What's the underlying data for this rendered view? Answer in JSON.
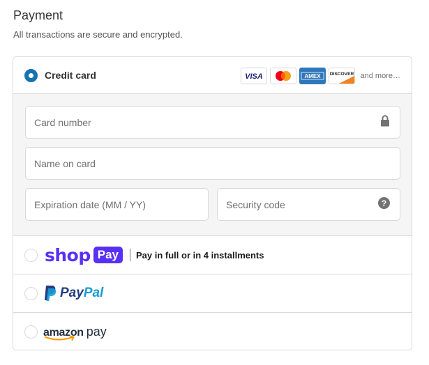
{
  "header": {
    "title": "Payment",
    "subtitle": "All transactions are secure and encrypted."
  },
  "credit_card": {
    "label": "Credit card",
    "selected": true,
    "card_brands": [
      {
        "name": "VISA",
        "icon": "visa-icon"
      },
      {
        "name": "Mastercard",
        "icon": "mastercard-icon"
      },
      {
        "name": "AMEX",
        "icon": "amex-icon"
      },
      {
        "name": "DISCOVER",
        "icon": "discover-icon"
      }
    ],
    "more_label": "and more…",
    "fields": {
      "card_number_placeholder": "Card number",
      "name_on_card_placeholder": "Name on card",
      "expiration_placeholder": "Expiration date (MM / YY)",
      "security_code_placeholder": "Security code"
    }
  },
  "shop_pay": {
    "shop_text": "shop",
    "pay_text": "Pay",
    "description": "Pay in full or in 4 installments",
    "selected": false
  },
  "paypal": {
    "pay_text": "Pay",
    "pal_text": "Pal",
    "selected": false
  },
  "amazon_pay": {
    "amazon_text": "amazon",
    "pay_text": "pay",
    "selected": false
  },
  "colors": {
    "accent": "#1773b0",
    "border": "#d9d9d9",
    "shop_pay_purple": "#5a31f4",
    "paypal_dark": "#253b80",
    "paypal_light": "#179bd7",
    "form_background": "#f5f5f5"
  }
}
